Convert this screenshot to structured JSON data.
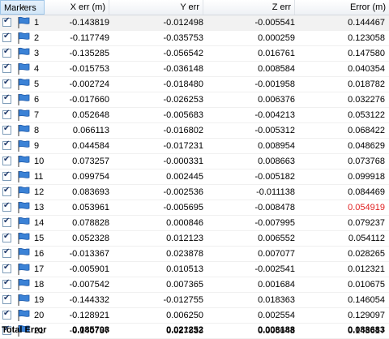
{
  "columns": {
    "markers": "Markers",
    "x_err": "X err (m)",
    "y_err": "Y err",
    "z_err": "Z err",
    "error": "Error (m)"
  },
  "rows": [
    {
      "id": "1",
      "x": "-0.143819",
      "y": "-0.012498",
      "z": "-0.005541",
      "e": "0.144467"
    },
    {
      "id": "2",
      "x": "-0.117749",
      "y": "-0.035753",
      "z": "0.000259",
      "e": "0.123058"
    },
    {
      "id": "3",
      "x": "-0.135285",
      "y": "-0.056542",
      "z": "0.016761",
      "e": "0.147580"
    },
    {
      "id": "4",
      "x": "-0.015753",
      "y": "-0.036148",
      "z": "0.008584",
      "e": "0.040354"
    },
    {
      "id": "5",
      "x": "-0.002724",
      "y": "-0.018480",
      "z": "-0.001958",
      "e": "0.018782"
    },
    {
      "id": "6",
      "x": "-0.017660",
      "y": "-0.026253",
      "z": "0.006376",
      "e": "0.032276"
    },
    {
      "id": "7",
      "x": "0.052648",
      "y": "-0.005683",
      "z": "-0.004213",
      "e": "0.053122"
    },
    {
      "id": "8",
      "x": "0.066113",
      "y": "-0.016802",
      "z": "-0.005312",
      "e": "0.068422"
    },
    {
      "id": "9",
      "x": "0.044584",
      "y": "-0.017231",
      "z": "0.008954",
      "e": "0.048629"
    },
    {
      "id": "10",
      "x": "0.073257",
      "y": "-0.000331",
      "z": "0.008663",
      "e": "0.073768"
    },
    {
      "id": "11",
      "x": "0.099754",
      "y": "0.002445",
      "z": "-0.005182",
      "e": "0.099918"
    },
    {
      "id": "12",
      "x": "0.083693",
      "y": "-0.002536",
      "z": "-0.011138",
      "e": "0.084469"
    },
    {
      "id": "13",
      "x": "0.053961",
      "y": "-0.005695",
      "z": "-0.008478",
      "e": "0.054919",
      "highlight": true
    },
    {
      "id": "14",
      "x": "0.078828",
      "y": "0.000846",
      "z": "-0.007995",
      "e": "0.079237"
    },
    {
      "id": "15",
      "x": "0.052328",
      "y": "0.012123",
      "z": "0.006552",
      "e": "0.054112"
    },
    {
      "id": "16",
      "x": "-0.013367",
      "y": "0.023878",
      "z": "0.007077",
      "e": "0.028265"
    },
    {
      "id": "17",
      "x": "-0.005901",
      "y": "0.010513",
      "z": "-0.002541",
      "e": "0.012321"
    },
    {
      "id": "18",
      "x": "-0.007542",
      "y": "0.007365",
      "z": "0.001684",
      "e": "0.010675"
    },
    {
      "id": "19",
      "x": "-0.144332",
      "y": "-0.012755",
      "z": "0.018363",
      "e": "0.146054"
    },
    {
      "id": "20",
      "x": "-0.128921",
      "y": "0.006250",
      "z": "0.002554",
      "e": "0.129097"
    },
    {
      "id": "21",
      "x": "-0.140737",
      "y": "0.027833",
      "z": "0.006643",
      "e": "0.143617"
    }
  ],
  "total": {
    "label": "Total Error",
    "x": "0.085708",
    "y": "0.021252",
    "z": "0.008188",
    "e": "0.088683"
  },
  "colors": {
    "highlight_error": "#e02020",
    "flag_blue": "#3b82d6",
    "header_selected": "#d2e6f7"
  },
  "icons": {
    "sort": "sort-up-icon",
    "checkbox": "checkbox-checked-icon",
    "flag": "marker-flag-icon"
  }
}
